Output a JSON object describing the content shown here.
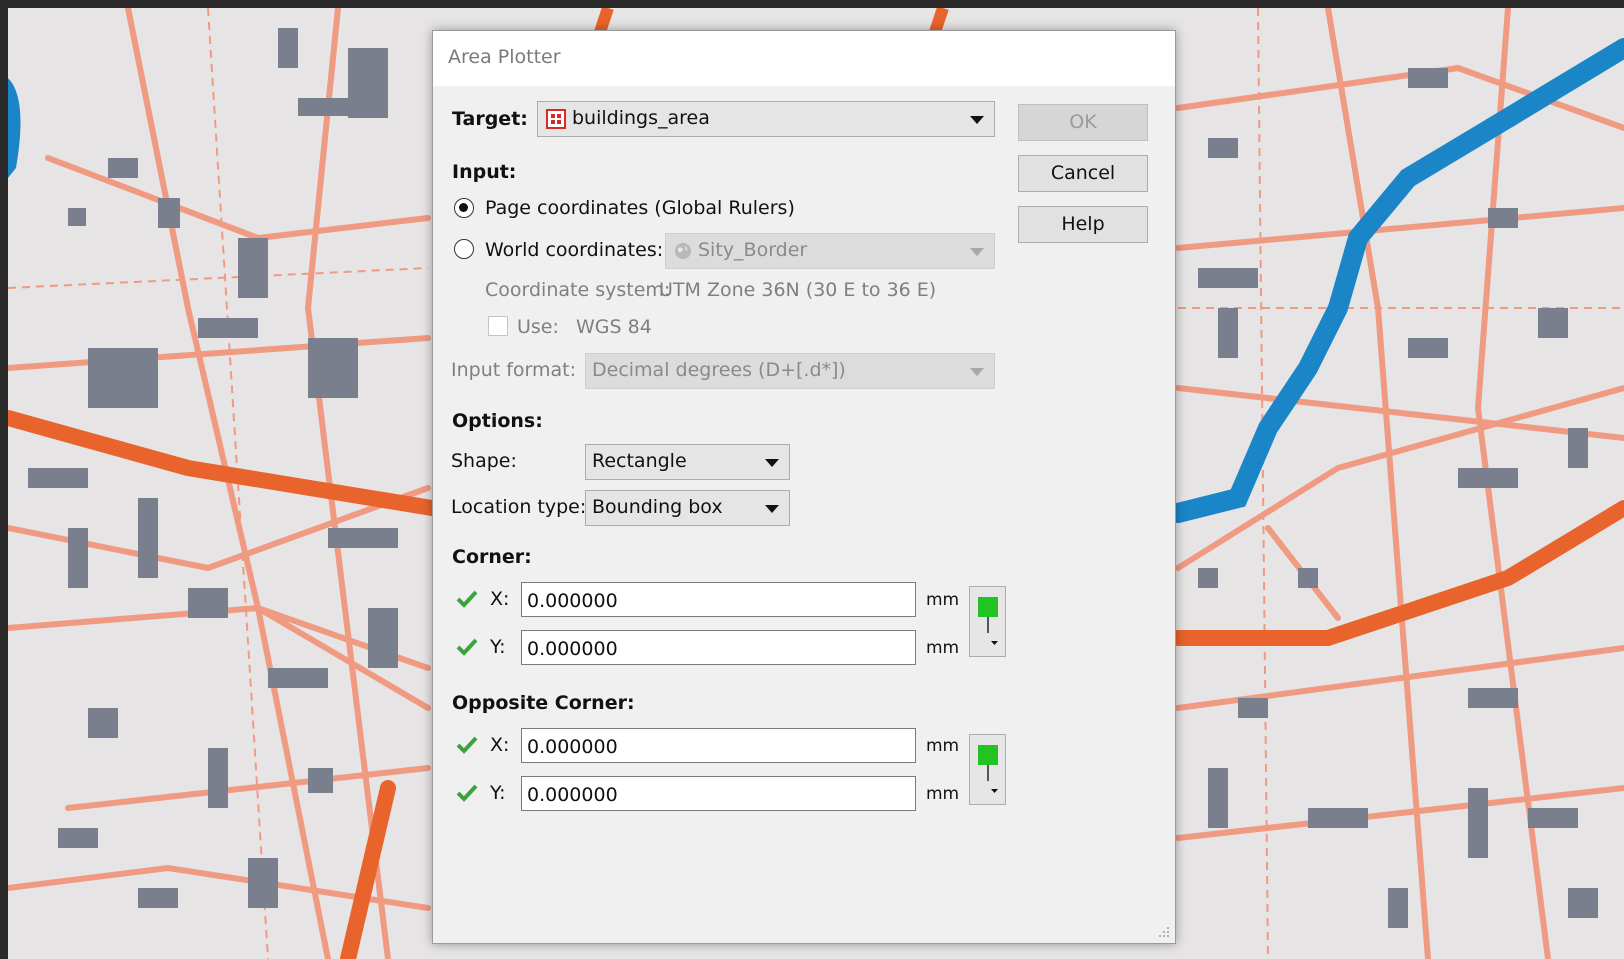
{
  "dialog": {
    "title": "Area Plotter",
    "target": {
      "label": "Target:",
      "value": "buildings_area",
      "icon": "layer-table-icon"
    },
    "buttons": {
      "ok": "OK",
      "cancel": "Cancel",
      "help": "Help"
    },
    "input": {
      "heading": "Input:",
      "page_coords_label": "Page coordinates (Global Rulers)",
      "world_coords_label": "World coordinates:",
      "world_layer": "Sity_Border",
      "coord_system_label": "Coordinate system:",
      "coord_system_value": "UTM Zone 36N (30 E to 36 E)",
      "use_label": "Use:",
      "use_value": "WGS 84",
      "format_label": "Input format:",
      "format_value": "Decimal degrees (D+[.d*])",
      "selected": "page"
    },
    "options": {
      "heading": "Options:",
      "shape_label": "Shape:",
      "shape_value": "Rectangle",
      "location_label": "Location type:",
      "location_value": "Bounding box"
    },
    "corner": {
      "heading": "Corner:",
      "x_label": "X:",
      "x_value": "0.000000",
      "x_unit": "mm",
      "y_label": "Y:",
      "y_value": "0.000000",
      "y_unit": "mm"
    },
    "opposite_corner": {
      "heading": "Opposite Corner:",
      "x_label": "X:",
      "x_value": "0.000000",
      "x_unit": "mm",
      "y_label": "Y:",
      "y_value": "0.000000",
      "y_unit": "mm"
    }
  },
  "colors": {
    "map_bg": "#e6e4e4",
    "building": "#7a7f8e",
    "road_major": "#e8642c",
    "road_minor": "#f09a82",
    "river": "#1a86c8",
    "check": "#3aa43a",
    "pin": "#22c322"
  }
}
